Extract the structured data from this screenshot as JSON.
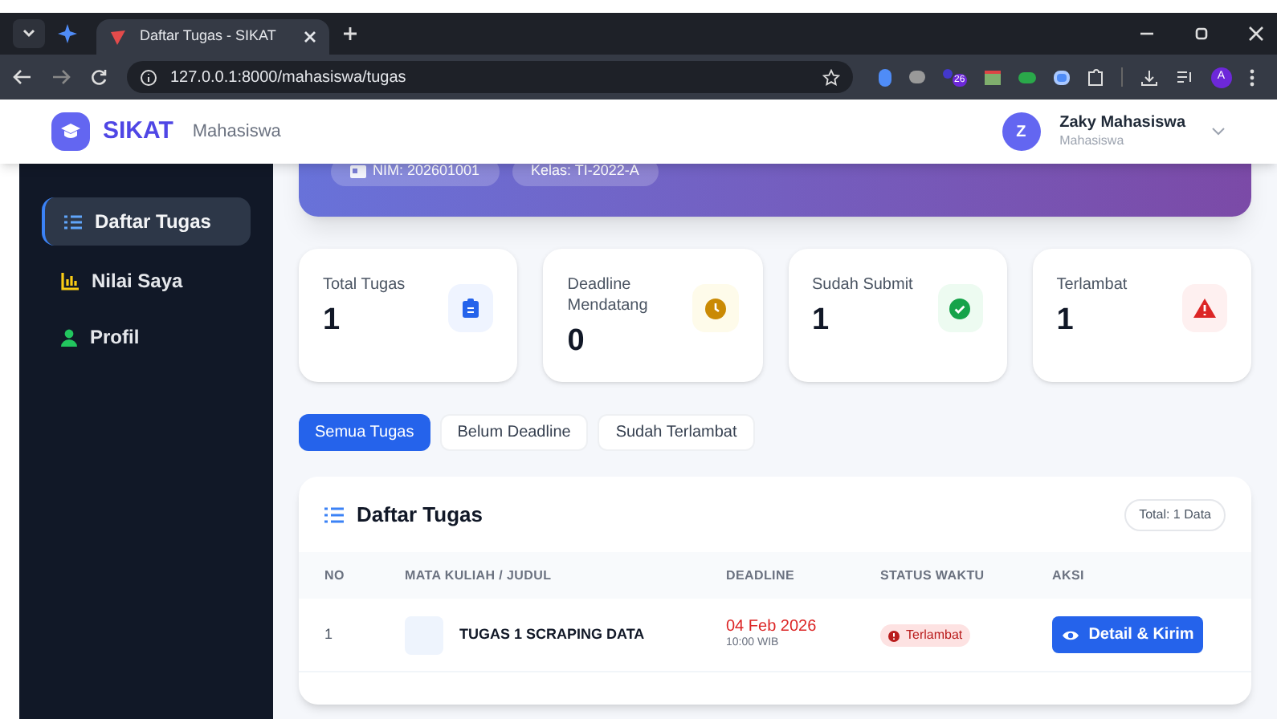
{
  "browser": {
    "tab_title": "Daftar Tugas - SIKAT",
    "url": "127.0.0.1:8000/mahasiswa/tugas",
    "extension_badge": "26",
    "profile_initial": "A"
  },
  "header": {
    "brand": "SIKAT",
    "role": "Mahasiswa",
    "user": {
      "initial": "Z",
      "name": "Zaky Mahasiswa",
      "role": "Mahasiswa"
    }
  },
  "sidebar": {
    "items": [
      {
        "label": "Daftar Tugas",
        "kind": "list",
        "selected": true
      },
      {
        "label": "Nilai Saya",
        "kind": "chart",
        "selected": false
      },
      {
        "label": "Profil",
        "kind": "user",
        "selected": false
      }
    ]
  },
  "banner": {
    "badges": [
      {
        "label": "NIM: 202601001",
        "kind": "id"
      },
      {
        "label": "Kelas: TI-2022-A",
        "kind": "plain"
      }
    ]
  },
  "stats": [
    {
      "label": "Total Tugas",
      "value": "1",
      "kind": "total"
    },
    {
      "label": "Deadline Mendatang",
      "value": "0",
      "kind": "upcoming"
    },
    {
      "label": "Sudah Submit",
      "value": "1",
      "kind": "done"
    },
    {
      "label": "Terlambat",
      "value": "1",
      "kind": "late"
    }
  ],
  "filters": [
    {
      "label": "Semua Tugas",
      "selected": true
    },
    {
      "label": "Belum Deadline",
      "selected": false
    },
    {
      "label": "Sudah Terlambat",
      "selected": false
    }
  ],
  "table": {
    "title": "Daftar Tugas",
    "total": "Total: 1 Data",
    "columns": [
      "NO",
      "MATA KULIAH / JUDUL",
      "DEADLINE",
      "STATUS WAKTU",
      "AKSI"
    ],
    "rows": [
      {
        "no": "1",
        "title": "TUGAS 1 SCRAPING DATA",
        "deadline_date": "04 Feb 2026",
        "deadline_time": "10:00 WIB",
        "status": "Terlambat",
        "action": "Detail & Kirim"
      }
    ]
  }
}
